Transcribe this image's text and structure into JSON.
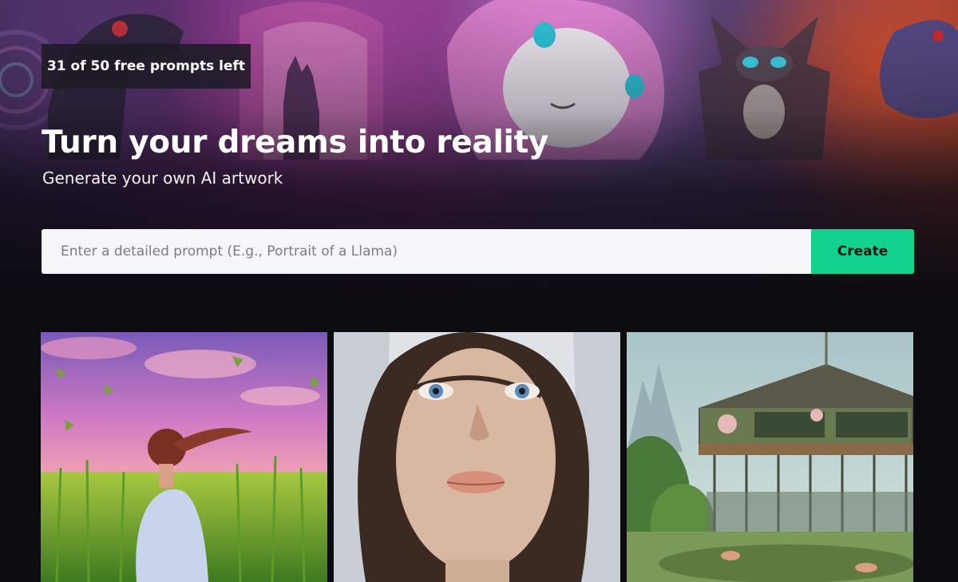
{
  "header": {
    "prompts_badge": "31 of 50 free prompts left",
    "title": "Turn your dreams into reality",
    "subtitle": "Generate your own AI artwork"
  },
  "prompt": {
    "placeholder": "Enter a detailed prompt (E.g., Portrait of a Llama)",
    "value": "",
    "create_label": "Create"
  },
  "colors": {
    "accent": "#12d28d",
    "page_background": "#0b0b10",
    "input_background": "#f5f6f7"
  },
  "gallery": {
    "images": [
      {
        "subject": "girl in cornfield artwork"
      },
      {
        "subject": "woman portrait artwork"
      },
      {
        "subject": "carousel artwork"
      }
    ]
  }
}
